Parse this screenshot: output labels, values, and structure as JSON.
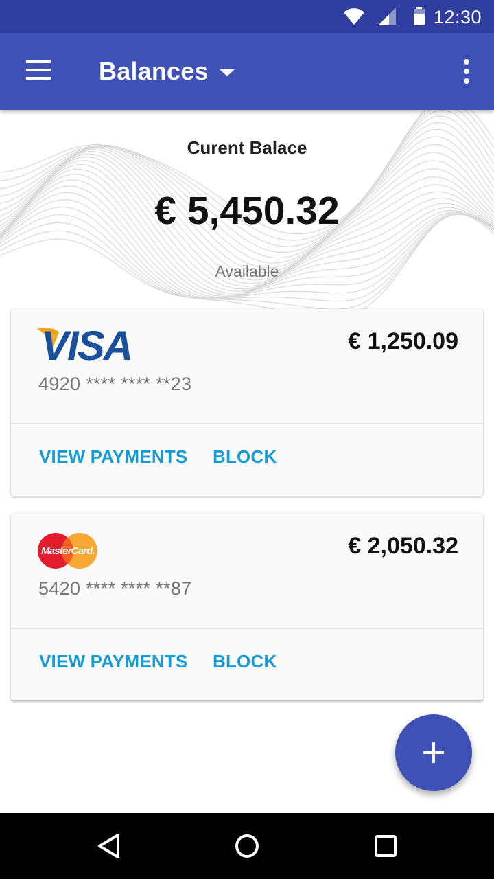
{
  "status_bar": {
    "time": "12:30",
    "icons": [
      "wifi-icon",
      "signal-icon",
      "battery-icon"
    ]
  },
  "app_bar": {
    "title": "Balances",
    "icons": [
      "menu-icon",
      "dropdown-caret-icon",
      "more-vert-icon"
    ]
  },
  "hero": {
    "label": "Curent Balace",
    "amount": "€ 5,450.32",
    "sublabel": "Available"
  },
  "cards": [
    {
      "brand": "VISA",
      "number": "4920 **** **** **23",
      "amount": "€ 1,250.09",
      "actions": [
        "VIEW PAYMENTS",
        "BLOCK"
      ]
    },
    {
      "brand": "MasterCard",
      "number": "5420 **** **** **87",
      "amount": "€ 2,050.32",
      "actions": [
        "VIEW PAYMENTS",
        "BLOCK"
      ]
    }
  ],
  "fab": {
    "icon": "add-icon"
  },
  "nav_bar": {
    "icons": [
      "back-icon",
      "home-icon",
      "recents-icon"
    ]
  },
  "colors": {
    "status_bar": "#303f9f",
    "primary": "#3f51b5",
    "accent_text": "#159bd6",
    "visa_blue": "#1a4f9c",
    "visa_gold": "#f2a51a",
    "mastercard_red": "#e21b2d",
    "mastercard_yellow": "#f7a833"
  }
}
